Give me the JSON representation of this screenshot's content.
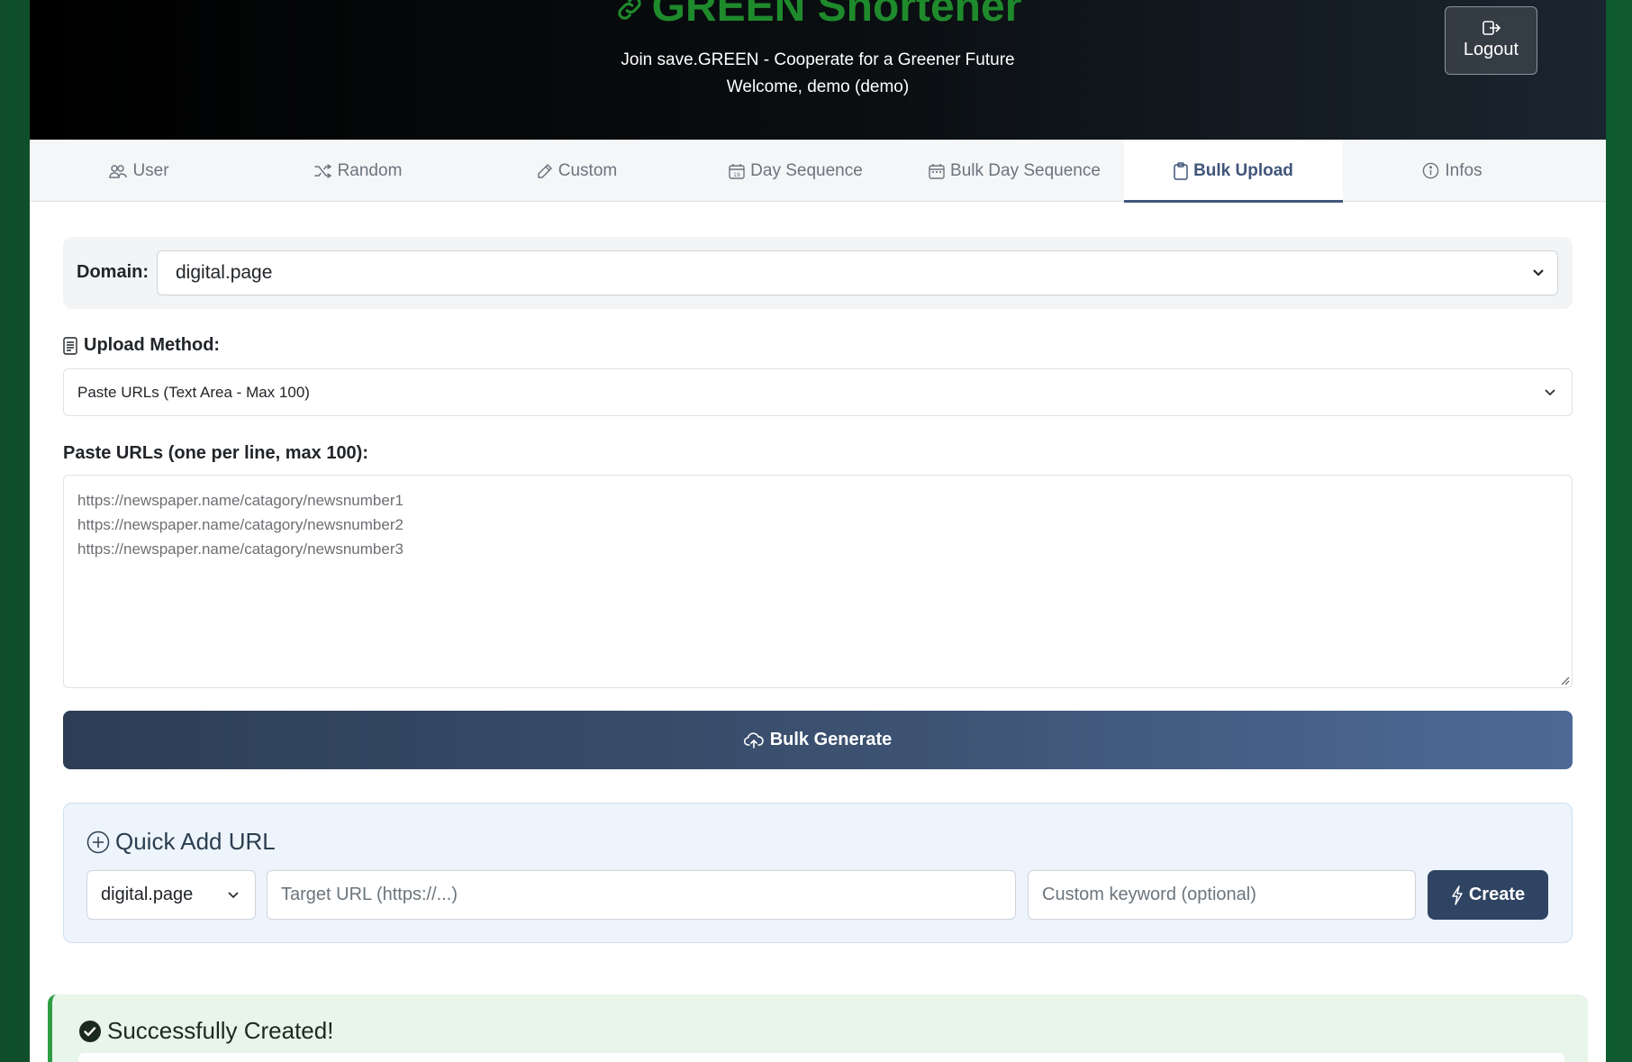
{
  "header": {
    "brand": "GREEN Shortener",
    "tagline": "Join save.GREEN - Cooperate for a Greener Future",
    "welcome": "Welcome, demo (demo)",
    "logout_label": "Logout"
  },
  "tabs": [
    {
      "label": "User",
      "icon": "users-icon"
    },
    {
      "label": "Random",
      "icon": "shuffle-icon"
    },
    {
      "label": "Custom",
      "icon": "pencil-icon"
    },
    {
      "label": "Day Sequence",
      "icon": "calendar-day-icon"
    },
    {
      "label": "Bulk Day Sequence",
      "icon": "calendar-week-icon"
    },
    {
      "label": "Bulk Upload",
      "icon": "clipboard-icon",
      "active": true
    },
    {
      "label": "Infos",
      "icon": "info-icon"
    }
  ],
  "form": {
    "domain_label": "Domain:",
    "domain_value": "digital.page",
    "method_label": "Upload Method:",
    "method_value": "Paste URLs (Text Area - Max 100)",
    "urls_label": "Paste URLs (one per line, max 100):",
    "urls_value": "https://newspaper.name/catagory/newsnumber1\nhttps://newspaper.name/catagory/newsnumber2\nhttps://newspaper.name/catagory/newsnumber3",
    "bulk_button": "Bulk Generate"
  },
  "quick_add": {
    "title": "Quick Add URL",
    "domain_value": "digital.page",
    "target_placeholder": "Target URL (https://...)",
    "keyword_placeholder": "Custom keyword (optional)",
    "create_label": "Create"
  },
  "success": {
    "title": "Successfully Created!"
  },
  "colors": {
    "brand_green": "#1f8a2c",
    "accent_navy": "#41557a",
    "success_green": "#2e9e44"
  }
}
